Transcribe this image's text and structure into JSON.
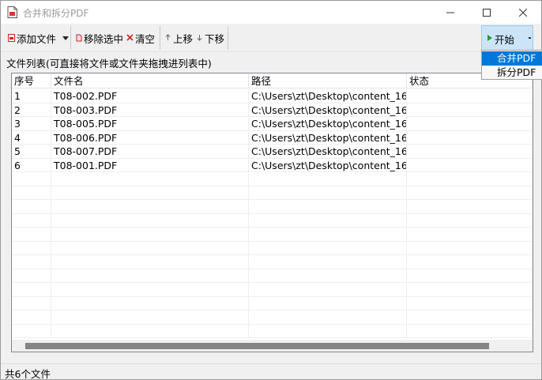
{
  "window": {
    "title": "合并和拆分PDF",
    "icon": "pdf-document-icon"
  },
  "toolbar": {
    "add_files": "添加文件",
    "remove_selected": "移除选中",
    "clear": "清空",
    "move_up": "上移",
    "move_down": "下移",
    "start": "开始"
  },
  "start_menu": {
    "items": [
      "合并PDF",
      "拆分PDF"
    ],
    "selected_index": 0
  },
  "list": {
    "caption": "文件列表(可直接将文件或文件夹拖拽进列表中)",
    "columns": [
      "序号",
      "文件名",
      "路径",
      "状态"
    ],
    "rows": [
      {
        "index": "1",
        "name": "T08-002.PDF",
        "path": "C:\\Users\\zt\\Desktop\\content_16...",
        "status": ""
      },
      {
        "index": "2",
        "name": "T08-003.PDF",
        "path": "C:\\Users\\zt\\Desktop\\content_16...",
        "status": ""
      },
      {
        "index": "3",
        "name": "T08-005.PDF",
        "path": "C:\\Users\\zt\\Desktop\\content_16...",
        "status": ""
      },
      {
        "index": "4",
        "name": "T08-006.PDF",
        "path": "C:\\Users\\zt\\Desktop\\content_16...",
        "status": ""
      },
      {
        "index": "5",
        "name": "T08-007.PDF",
        "path": "C:\\Users\\zt\\Desktop\\content_16...",
        "status": ""
      },
      {
        "index": "6",
        "name": "T08-001.PDF",
        "path": "C:\\Users\\zt\\Desktop\\content_16...",
        "status": ""
      }
    ]
  },
  "status_bar": {
    "text": "共6个文件"
  },
  "colors": {
    "accent": "#0078d7",
    "start_button_bg": "#cce4f7",
    "play_icon": "#19a02a",
    "remove_icon": "#d42020"
  }
}
